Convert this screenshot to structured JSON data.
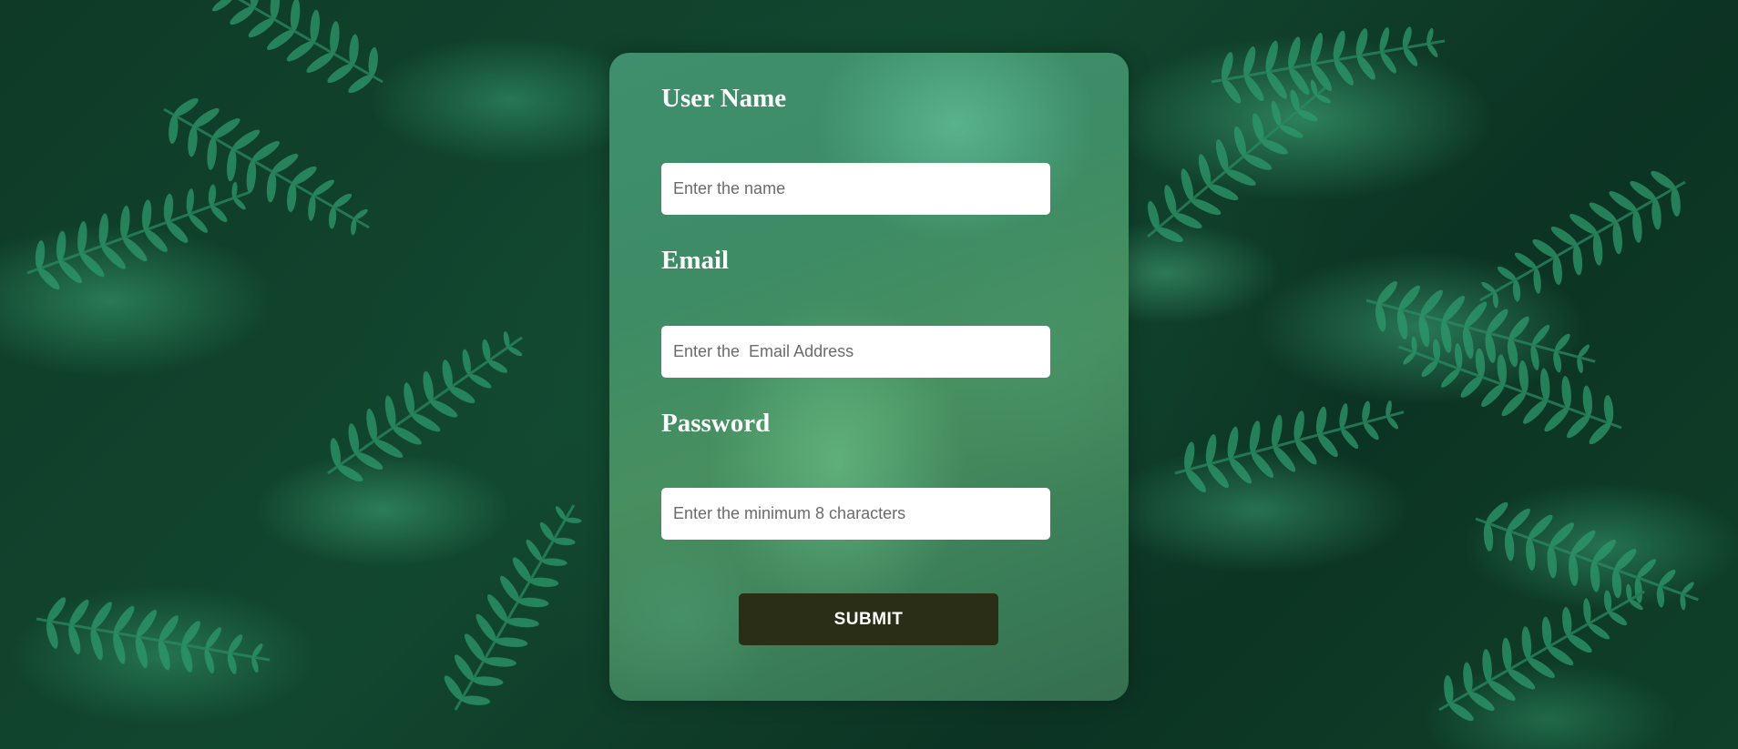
{
  "form": {
    "username": {
      "label": "User Name",
      "placeholder": "Enter the name",
      "value": ""
    },
    "email": {
      "label": "Email",
      "placeholder": "Enter the  Email Address",
      "value": ""
    },
    "password": {
      "label": "Password",
      "placeholder": "Enter the minimum 8 characters",
      "value": ""
    },
    "submit_label": "SUBMIT"
  },
  "colors": {
    "background": "#0f4029",
    "card": "#3f8f6e",
    "label_text": "#ffffff",
    "input_background": "#ffffff",
    "button_background": "#2b2e16",
    "button_text": "#ffffff"
  }
}
